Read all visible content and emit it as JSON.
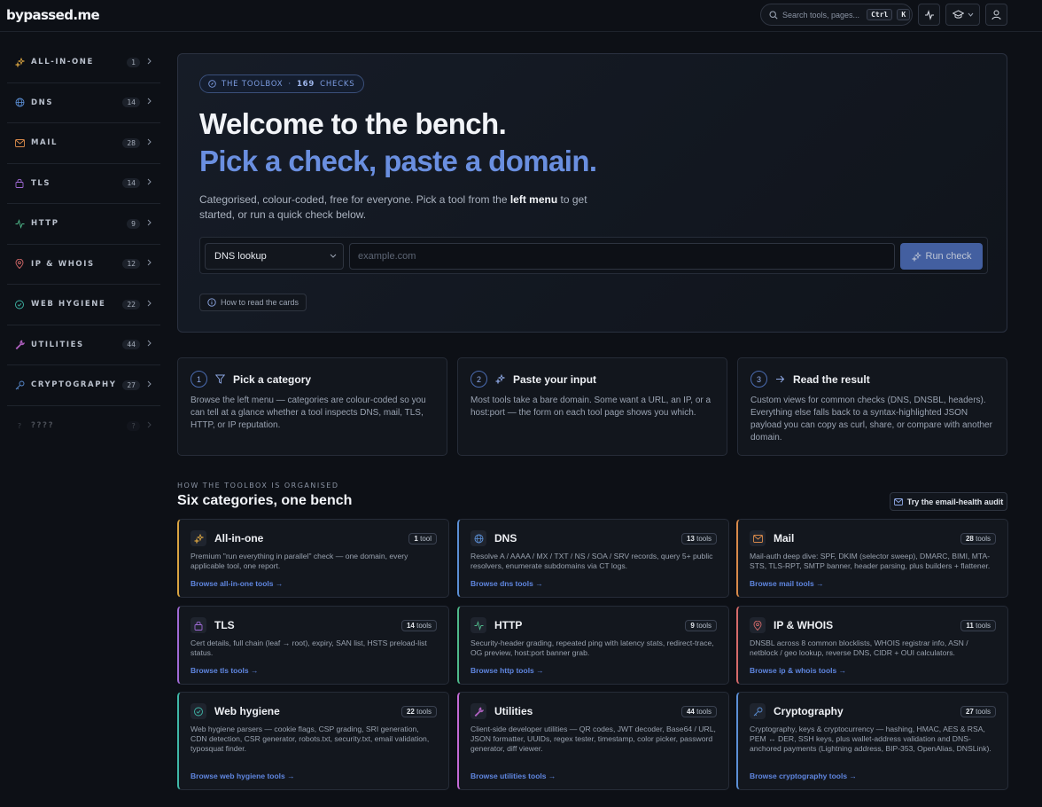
{
  "app": {
    "logo": "bypassed.me",
    "search_placeholder": "Search tools, pages...",
    "search_key1": "Ctrl",
    "search_key2": "K"
  },
  "sidebar": {
    "items": [
      {
        "label": "ALL-IN-ONE",
        "count": "1",
        "icon": "sparkles-icon",
        "color": "#d9a441"
      },
      {
        "label": "DNS",
        "count": "14",
        "icon": "globe-icon",
        "color": "#5b8fd6"
      },
      {
        "label": "MAIL",
        "count": "28",
        "icon": "mail-icon",
        "color": "#d98a4a"
      },
      {
        "label": "TLS",
        "count": "14",
        "icon": "lock-icon",
        "color": "#a06ad6"
      },
      {
        "label": "HTTP",
        "count": "9",
        "icon": "activity-icon",
        "color": "#4fb98a"
      },
      {
        "label": "IP & WHOIS",
        "count": "12",
        "icon": "map-pin-icon",
        "color": "#d66a6a"
      },
      {
        "label": "WEB HYGIENE",
        "count": "22",
        "icon": "shield-icon",
        "color": "#3fb8a8"
      },
      {
        "label": "UTILITIES",
        "count": "44",
        "icon": "wrench-icon",
        "color": "#c46ad6"
      },
      {
        "label": "CRYPTOGRAPHY",
        "count": "27",
        "icon": "key-icon",
        "color": "#5b8fd6"
      },
      {
        "label": "????",
        "count": "?",
        "icon": "question-icon",
        "color": "#8a93a3"
      }
    ]
  },
  "hero": {
    "pill_label": "THE TOOLBOX",
    "pill_sep": "·",
    "pill_count": "169",
    "pill_suffix": "CHECKS",
    "title": "Welcome to the bench.",
    "subtitle": "Pick a check, paste a domain.",
    "desc_pre": "Categorised, colour-coded, free for everyone. Pick a tool from the ",
    "desc_bold": "left menu",
    "desc_post": " to get started, or run a quick check below.",
    "select_value": "DNS lookup",
    "input_placeholder": "example.com",
    "run_label": "Run check",
    "howto_label": "How to read the cards"
  },
  "steps": [
    {
      "num": "1",
      "title": "Pick a category",
      "body": "Browse the left menu — categories are colour-coded so you can tell at a glance whether a tool inspects DNS, mail, TLS, HTTP, or IP reputation.",
      "icon": "filter-icon"
    },
    {
      "num": "2",
      "title": "Paste your input",
      "body": "Most tools take a bare domain. Some want a URL, an IP, or a host:port — the form on each tool page shows you which.",
      "icon": "sparkles-icon"
    },
    {
      "num": "3",
      "title": "Read the result",
      "body": "Custom views for common checks (DNS, DNSBL, headers). Everything else falls back to a syntax-highlighted JSON payload you can copy as curl, share, or compare with another domain.",
      "icon": "arrow-right-icon"
    }
  ],
  "section": {
    "kicker": "HOW THE TOOLBOX IS ORGANISED",
    "title": "Six categories, one bench",
    "audit_label": "Try the email-health audit"
  },
  "categories": [
    {
      "title": "All-in-one",
      "count_num": "1",
      "count_word": "tool",
      "desc": "Premium \"run everything in parallel\" check — one domain, every applicable tool, one report.",
      "link": "Browse all-in-one tools →",
      "icon": "sparkles-icon",
      "color": "#d9a441"
    },
    {
      "title": "DNS",
      "count_num": "13",
      "count_word": "tools",
      "desc": "Resolve A / AAAA / MX / TXT / NS / SOA / SRV records, query 5+ public resolvers, enumerate subdomains via CT logs.",
      "link": "Browse dns tools →",
      "icon": "globe-icon",
      "color": "#5b8fd6"
    },
    {
      "title": "Mail",
      "count_num": "28",
      "count_word": "tools",
      "desc": "Mail-auth deep dive: SPF, DKIM (selector sweep), DMARC, BIMI, MTA-STS, TLS-RPT, SMTP banner, header parsing, plus builders + flattener.",
      "link": "Browse mail tools →",
      "icon": "mail-icon",
      "color": "#d98a4a"
    },
    {
      "title": "TLS",
      "count_num": "14",
      "count_word": "tools",
      "desc": "Cert details, full chain (leaf → root), expiry, SAN list, HSTS preload-list status.",
      "link": "Browse tls tools →",
      "icon": "lock-icon",
      "color": "#a06ad6"
    },
    {
      "title": "HTTP",
      "count_num": "9",
      "count_word": "tools",
      "desc": "Security-header grading, repeated ping with latency stats, redirect-trace, OG preview, host:port banner grab.",
      "link": "Browse http tools →",
      "icon": "activity-icon",
      "color": "#4fb98a"
    },
    {
      "title": "IP & WHOIS",
      "count_num": "11",
      "count_word": "tools",
      "desc": "DNSBL across 8 common blocklists, WHOIS registrar info, ASN / netblock / geo lookup, reverse DNS, CIDR + OUI calculators.",
      "link": "Browse ip & whois tools →",
      "icon": "map-pin-icon",
      "color": "#d66a6a"
    },
    {
      "title": "Web hygiene",
      "count_num": "22",
      "count_word": "tools",
      "desc": "Web hygiene parsers — cookie flags, CSP grading, SRI generation, CDN detection, CSR generator, robots.txt, security.txt, email validation, typosquat finder.",
      "link": "Browse web hygiene tools →",
      "icon": "shield-icon",
      "color": "#3fb8a8"
    },
    {
      "title": "Utilities",
      "count_num": "44",
      "count_word": "tools",
      "desc": "Client-side developer utilities — QR codes, JWT decoder, Base64 / URL, JSON formatter, UUIDs, regex tester, timestamp, color picker, password generator, diff viewer.",
      "link": "Browse utilities tools →",
      "icon": "wrench-icon",
      "color": "#c46ad6"
    },
    {
      "title": "Cryptography",
      "count_num": "27",
      "count_word": "tools",
      "desc": "Cryptography, keys & cryptocurrency — hashing, HMAC, AES & RSA, PEM ↔ DER, SSH keys, plus wallet-address validation and DNS-anchored payments (Lightning address, BIP-353, OpenAlias, DNSLink).",
      "link": "Browse cryptography tools →",
      "icon": "key-icon",
      "color": "#5b8fd6"
    }
  ]
}
